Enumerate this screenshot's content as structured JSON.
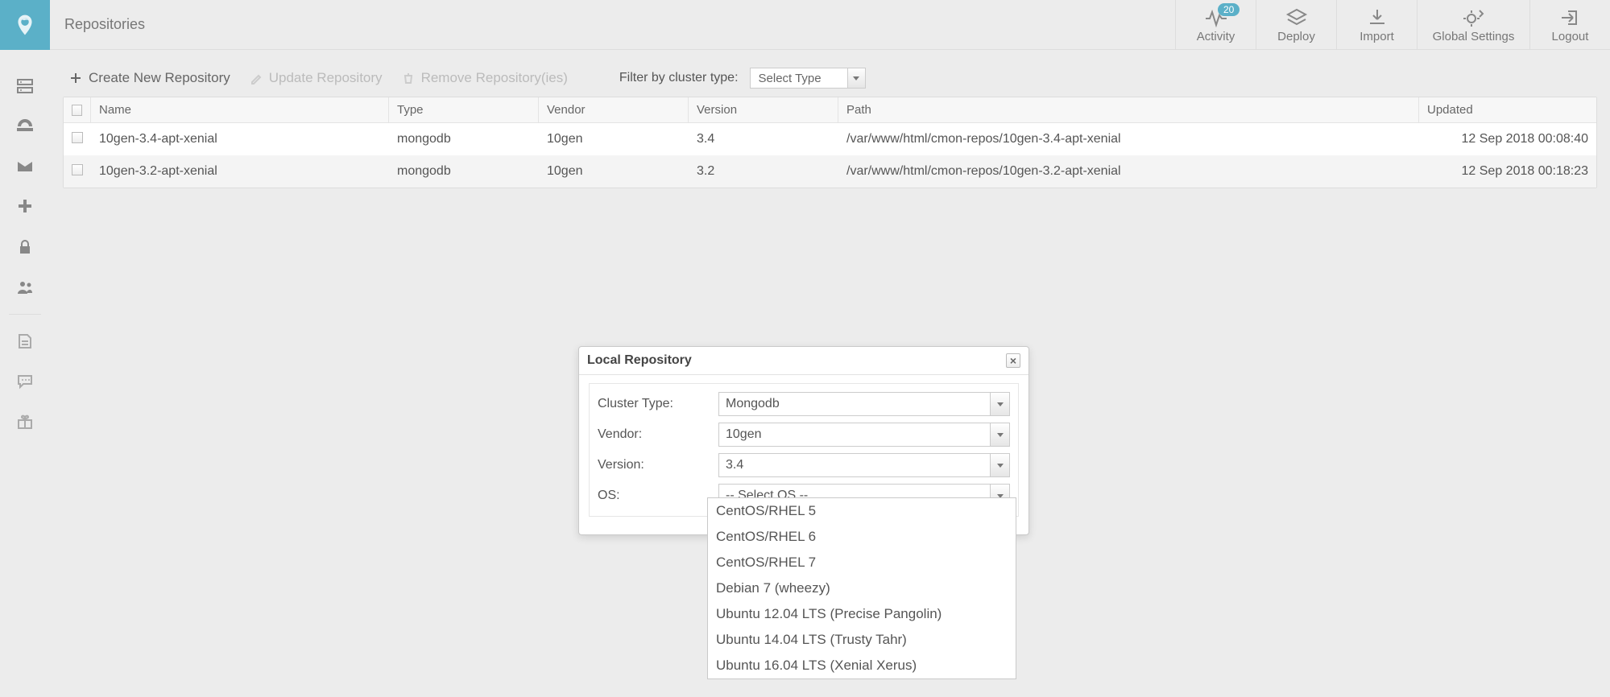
{
  "header": {
    "breadcrumb": "Repositories",
    "badge": "20",
    "actions": {
      "activity": "Activity",
      "deploy": "Deploy",
      "import": "Import",
      "settings": "Global Settings",
      "logout": "Logout"
    }
  },
  "toolbar": {
    "create": "Create New Repository",
    "update": "Update Repository",
    "remove": "Remove Repository(ies)",
    "filter_label": "Filter by cluster type:",
    "filter_value": "Select Type"
  },
  "columns": {
    "name": "Name",
    "type": "Type",
    "vendor": "Vendor",
    "version": "Version",
    "path": "Path",
    "updated": "Updated"
  },
  "rows": [
    {
      "name": "10gen-3.4-apt-xenial",
      "type": "mongodb",
      "vendor": "10gen",
      "version": "3.4",
      "path": "/var/www/html/cmon-repos/10gen-3.4-apt-xenial",
      "updated": "12 Sep 2018 00:08:40"
    },
    {
      "name": "10gen-3.2-apt-xenial",
      "type": "mongodb",
      "vendor": "10gen",
      "version": "3.2",
      "path": "/var/www/html/cmon-repos/10gen-3.2-apt-xenial",
      "updated": "12 Sep 2018 00:18:23"
    }
  ],
  "dialog": {
    "title": "Local Repository",
    "labels": {
      "cluster_type": "Cluster Type:",
      "vendor": "Vendor:",
      "version": "Version:",
      "os": "OS:"
    },
    "values": {
      "cluster_type": "Mongodb",
      "vendor": "10gen",
      "version": "3.4",
      "os": "-- Select OS --"
    },
    "os_options": [
      "CentOS/RHEL 5",
      "CentOS/RHEL 6",
      "CentOS/RHEL 7",
      "Debian 7 (wheezy)",
      "Ubuntu 12.04 LTS (Precise Pangolin)",
      "Ubuntu 14.04 LTS (Trusty Tahr)",
      "Ubuntu 16.04 LTS (Xenial Xerus)"
    ]
  }
}
